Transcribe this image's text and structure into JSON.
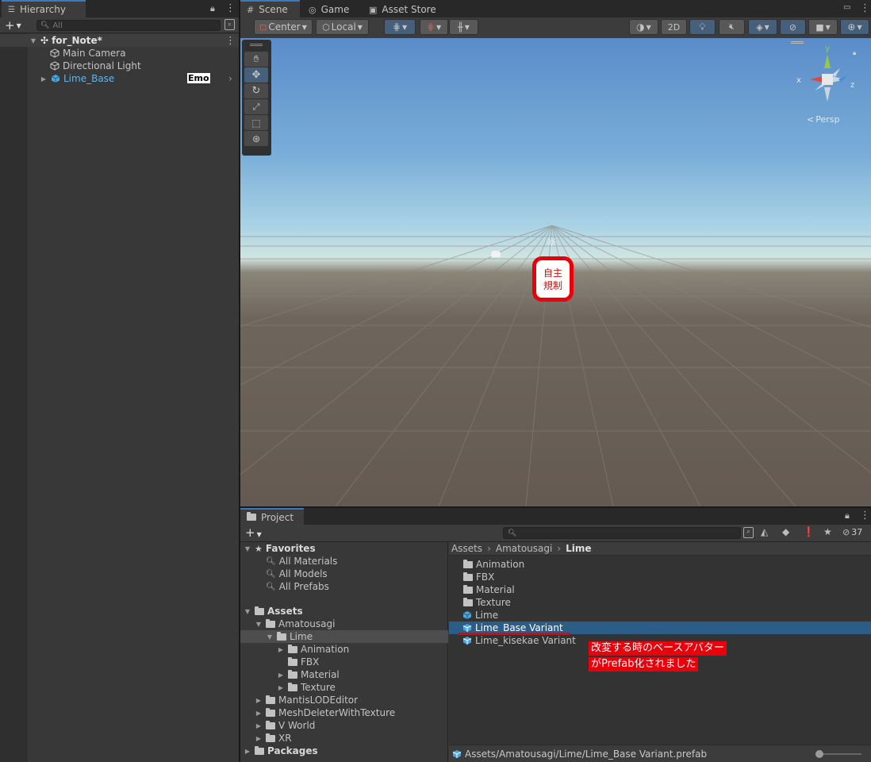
{
  "hierarchy": {
    "tab_label": "Hierarchy",
    "search_placeholder": "All",
    "scene_name": "for_Note*",
    "items": [
      {
        "label": "Main Camera"
      },
      {
        "label": "Directional Light"
      },
      {
        "label": "Lime_Base",
        "badge": "Emo"
      }
    ]
  },
  "scene_tabs": {
    "scene": "Scene",
    "game": "Game",
    "asset_store": "Asset Store"
  },
  "scene_toolbar": {
    "pivot": "Center",
    "space": "Local",
    "twod": "2D"
  },
  "gizmo": {
    "x": "x",
    "y": "y",
    "z": "z",
    "persp": "Persp"
  },
  "scene_overlay": {
    "line1": "自主",
    "line2": "規制"
  },
  "project": {
    "tab_label": "Project",
    "hidden_count": "37",
    "favorites": {
      "label": "Favorites",
      "items": [
        "All Materials",
        "All Models",
        "All Prefabs"
      ]
    },
    "assets_label": "Assets",
    "tree": {
      "amatousagi": "Amatousagi",
      "lime": "Lime",
      "lime_children": [
        "Animation",
        "FBX",
        "Material",
        "Texture"
      ],
      "others": [
        "MantisLODEditor",
        "MeshDeleterWithTexture",
        "V World",
        "XR"
      ],
      "packages": "Packages"
    },
    "breadcrumb": [
      "Assets",
      "Amatousagi",
      "Lime"
    ],
    "files": [
      {
        "label": "Animation",
        "kind": "folder"
      },
      {
        "label": "FBX",
        "kind": "folder"
      },
      {
        "label": "Material",
        "kind": "folder"
      },
      {
        "label": "Texture",
        "kind": "folder"
      },
      {
        "label": "Lime",
        "kind": "prefab"
      },
      {
        "label": "Lime_Base Variant",
        "kind": "prefab-variant",
        "selected": true
      },
      {
        "label": "Lime_kisekae Variant",
        "kind": "prefab-variant"
      }
    ],
    "note_line1": "改変する時のベースアバター",
    "note_line2": "がPrefab化されました",
    "status_path": "Assets/Amatousagi/Lime/Lime_Base Variant.prefab"
  },
  "colors": {
    "accent": "#2c5d87",
    "note_red": "#e8000b",
    "prefab_blue": "#4aa6dc"
  }
}
